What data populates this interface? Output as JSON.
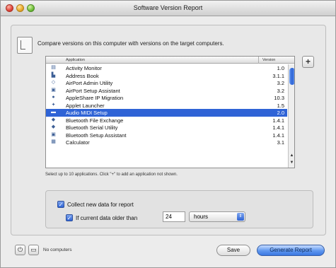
{
  "window": {
    "title": "Software Version Report"
  },
  "instructions": "Compare versions on this computer with versions on the target computers.",
  "table": {
    "headers": {
      "application": "Application",
      "version": "Version"
    },
    "rows": [
      {
        "icon": "activity-monitor-icon",
        "glyph": "▤",
        "name": "Activity Monitor",
        "version": "1.0",
        "selected": false
      },
      {
        "icon": "address-book-icon",
        "glyph": "▙",
        "name": "Address Book",
        "version": "3.1.1",
        "selected": false
      },
      {
        "icon": "airport-admin-icon",
        "glyph": "◇",
        "name": "AirPort Admin Utility",
        "version": "3.2",
        "selected": false
      },
      {
        "icon": "airport-setup-icon",
        "glyph": "▣",
        "name": "AirPort Setup Assistant",
        "version": "3.2",
        "selected": false
      },
      {
        "icon": "appleshare-icon",
        "glyph": "●",
        "name": "AppleShare IP Migration",
        "version": "10.3",
        "selected": false
      },
      {
        "icon": "applet-launcher-icon",
        "glyph": "✦",
        "name": "Applet Launcher",
        "version": "1.5",
        "selected": false
      },
      {
        "icon": "audio-midi-icon",
        "glyph": "▬",
        "name": "Audio MIDI Setup",
        "version": "2.0",
        "selected": true
      },
      {
        "icon": "bluetooth-file-exchange-icon",
        "glyph": "◆",
        "name": "Bluetooth File Exchange",
        "version": "1.4.1",
        "selected": false
      },
      {
        "icon": "bluetooth-serial-icon",
        "glyph": "◆",
        "name": "Bluetooth Serial Utility",
        "version": "1.4.1",
        "selected": false
      },
      {
        "icon": "bluetooth-setup-icon",
        "glyph": "▣",
        "name": "Bluetooth Setup Assistant",
        "version": "1.4.1",
        "selected": false
      },
      {
        "icon": "calculator-icon",
        "glyph": "▦",
        "name": "Calculator",
        "version": "3.1",
        "selected": false
      },
      {
        "icon": "blank-icon",
        "glyph": "",
        "name": "",
        "version": "",
        "selected": false
      },
      {
        "icon": "blank-icon",
        "glyph": "",
        "name": "",
        "version": "",
        "selected": false
      },
      {
        "icon": "blank-icon",
        "glyph": "",
        "name": "",
        "version": "",
        "selected": false
      }
    ]
  },
  "add_button_label": "+",
  "hint": "Select up to 10 applications. Click \"+\" to add an application not shown.",
  "options": {
    "collect_label": "Collect new data for report",
    "older_label": "If current data older than",
    "older_value": "24",
    "unit_selected": "hours"
  },
  "footer": {
    "status": "No computers",
    "save_label": "Save",
    "generate_label": "Generate Report"
  }
}
